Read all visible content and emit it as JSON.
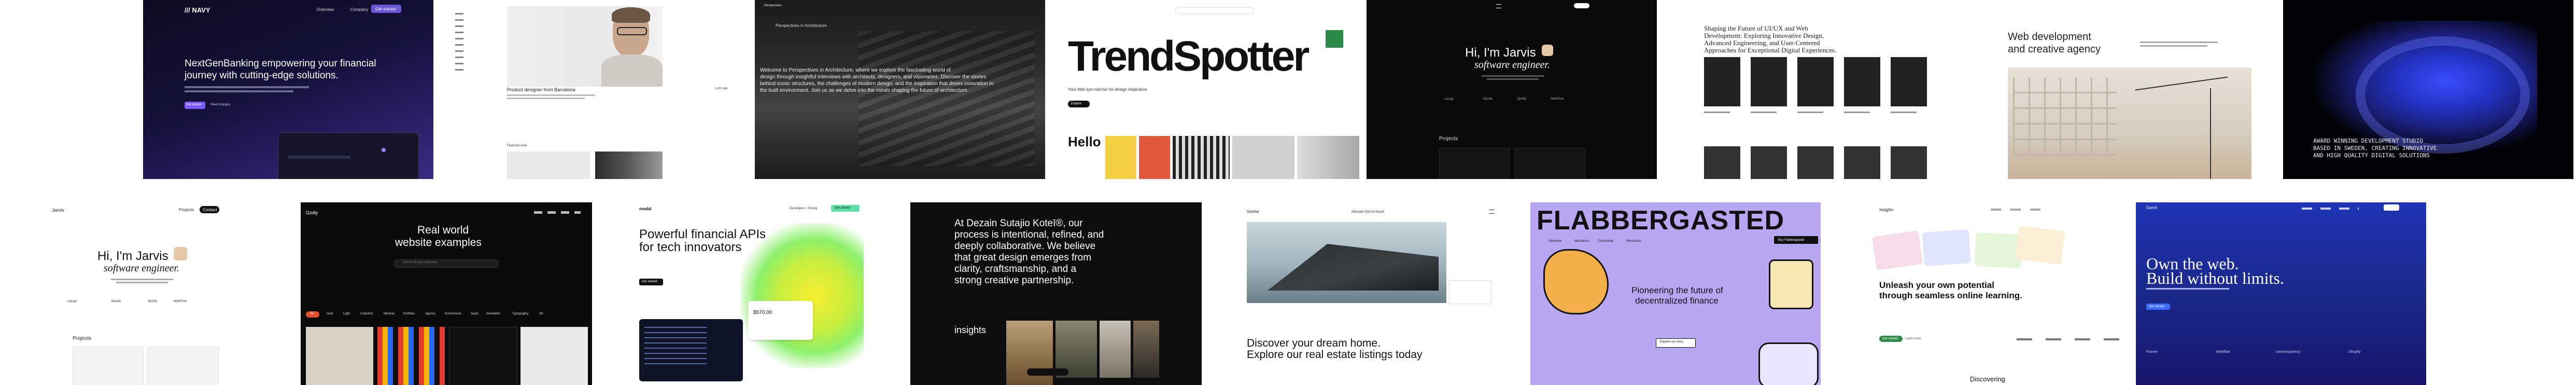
{
  "colors": {
    "nextgen_bg": "#0d0b24",
    "nextgen_accent": "#7a5cff",
    "lime": "#d7f04a",
    "teal": "#2a8a4a",
    "purple_bg": "#b9a6f3",
    "blue_bg": "#1b2a8f",
    "ink": "#111111",
    "paper": "#ffffff"
  },
  "t1": {
    "logo": "/// NAVY",
    "nav": [
      "Overview",
      "Company",
      "Get started"
    ],
    "headline1": "NextGenBanking empowering your financial",
    "headline2": "journey with cutting-edge solutions.",
    "cta": "Get started",
    "cta2": "Read changes"
  },
  "t2": {
    "caption": "Product designer from Barcelona",
    "link": "Let's talk",
    "section": "Featured work"
  },
  "t3": {
    "brand": "Perspectives",
    "title": "Perspectives in Architecture",
    "body1": "Welcome to Perspectives in Architecture, where we explore the fascinating world of",
    "body2": "design through insightful interviews with architects, designers, and visionaries. Discover the stories",
    "body3": "behind iconic structures, the challenges of modern design, and the inspiration that drives innovation in",
    "body4": "the built environment. Join us as we delve into the minds shaping the future of architecture."
  },
  "t4": {
    "title": "TrendSpotter",
    "subtitle": "Your little eye-catcher for design inspiration",
    "cta": "Explore",
    "hello": "Hello"
  },
  "t5": {
    "greeting": "Hi, I'm Jarvis",
    "role": "software engineer.",
    "projects": "Projects",
    "logos": [
      "LaLiga",
      "Mazda",
      "Spotify",
      "WebFlow"
    ]
  },
  "t6": {
    "headline": "Shaping the Future of UI/UX and Web Development: Exploring Innovative Design, Advanced Engineering, and User-Centered Approaches for Exceptional Digital Experiences."
  },
  "t7": {
    "headline1": "Web development",
    "headline2": "and creative agency"
  },
  "t8": {
    "line1": "AWARD WINNING DEVELOPMENT STUDIO",
    "line2": "BASED IN SWEDEN, CREATING INNOVATIVE",
    "line3": "AND HIGH QUALITY DIGITAL SOLUTIONS"
  },
  "t9": {
    "logo": "Jarvis",
    "nav": [
      "Projects",
      "Contact"
    ],
    "greeting": "Hi, I'm Jarvis",
    "role": "software engineer.",
    "projects": "Projects",
    "logos": [
      "LaLiga",
      "Mazda",
      "Spotify",
      "WebFlow"
    ]
  },
  "t10": {
    "logo": "Godly",
    "title1": "Real world",
    "title2": "website examples",
    "search": "Search design inspiration",
    "tags": [
      "All",
      "Dark",
      "Light",
      "Colourful",
      "Minimal",
      "Portfolio",
      "Agency",
      "Ecommerce",
      "SaaS",
      "Animation",
      "Typography",
      "3D"
    ]
  },
  "t11": {
    "logo": "modal",
    "nav": [
      "Developers",
      "Pricing",
      "Get started"
    ],
    "headline1": "Powerful financial APIs",
    "headline2": "for tech innovators",
    "cta": "Get started",
    "amount": "$570.00"
  },
  "t12": {
    "p1": "At Dezain Sutajio Koteī®, our",
    "p2": "process is intentional, refined, and",
    "p3": "deeply collaborative. We believe",
    "p4": "that great design emerges from",
    "p5": "clarity, craftsmanship, and a",
    "p6": "strong creative partnership.",
    "insights": "insights"
  },
  "t13": {
    "logo": "Sunrise",
    "nav": "Houses  Get in touch",
    "line1": "Discover your dream home.",
    "line2": "Explore our real estate listings today"
  },
  "t14": {
    "title": "FLABBERGASTED",
    "nav": [
      "Overview",
      "Mechanics",
      "Community",
      "Resources"
    ],
    "cta_top": "Buy Flabbergasted",
    "h1": "Pioneering the future of",
    "h2": "decentralized finance",
    "cta": "Explore our docs"
  },
  "t15": {
    "logo": "Insight+",
    "h1": "Unleash your own potential",
    "h2": "through seamless online learning.",
    "cta": "Get started",
    "cta2": "Learn more",
    "section": "Discovering"
  },
  "t16": {
    "logo": "Gen®",
    "h1": "Own the web.",
    "h2": "Build without limits.",
    "cta": "Get started",
    "logos": [
      "Framer",
      "Webflow",
      "Lemonsqueezy",
      "Shopify"
    ]
  }
}
